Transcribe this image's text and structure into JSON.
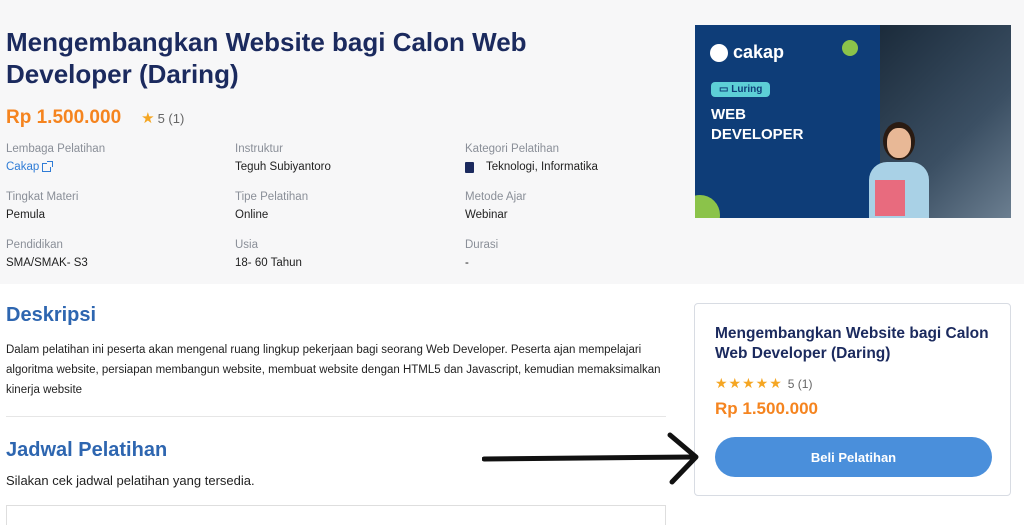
{
  "course": {
    "title": "Mengembangkan Website bagi Calon Web Developer (Daring)",
    "price": "Rp 1.500.000",
    "rating_value": "5 (1)"
  },
  "meta": [
    {
      "label": "Lembaga Pelatihan",
      "value": "Cakap"
    },
    {
      "label": "Instruktur",
      "value": "Teguh Subiyantoro"
    },
    {
      "label": "Kategori Pelatihan",
      "value": "Teknologi, Informatika"
    },
    {
      "label": "Tingkat Materi",
      "value": "Pemula"
    },
    {
      "label": "Tipe Pelatihan",
      "value": "Online"
    },
    {
      "label": "Metode Ajar",
      "value": "Webinar"
    },
    {
      "label": "Pendidikan",
      "value": "SMA/SMAK- S3"
    },
    {
      "label": "Usia",
      "value": "18- 60 Tahun"
    },
    {
      "label": "Durasi",
      "value": "-"
    }
  ],
  "banner": {
    "brand": "cakap",
    "mode": "Luring",
    "headline_1": "WEB",
    "headline_2": "DEVELOPER"
  },
  "description": {
    "heading": "Deskripsi",
    "text": "Dalam pelatihan ini peserta akan mengenal ruang lingkup pekerjaan bagi seorang Web Developer. Peserta ajan mempelajari algoritma website, persiapan membangun website, membuat website dengan HTML5 dan Javascript, kemudian memaksimalkan kinerja website"
  },
  "schedule": {
    "heading": "Jadwal Pelatihan",
    "text": "Silakan cek jadwal pelatihan yang tersedia."
  },
  "card": {
    "title": "Mengembangkan Website bagi Calon Web Developer (Daring)",
    "rating_value": "5 (1)",
    "price": "Rp 1.500.000",
    "buy_label": "Beli Pelatihan"
  },
  "colors": {
    "title": "#1b2a5e",
    "price": "#f5841f",
    "accent": "#4a8fdb",
    "section_heading": "#2e66b0"
  }
}
